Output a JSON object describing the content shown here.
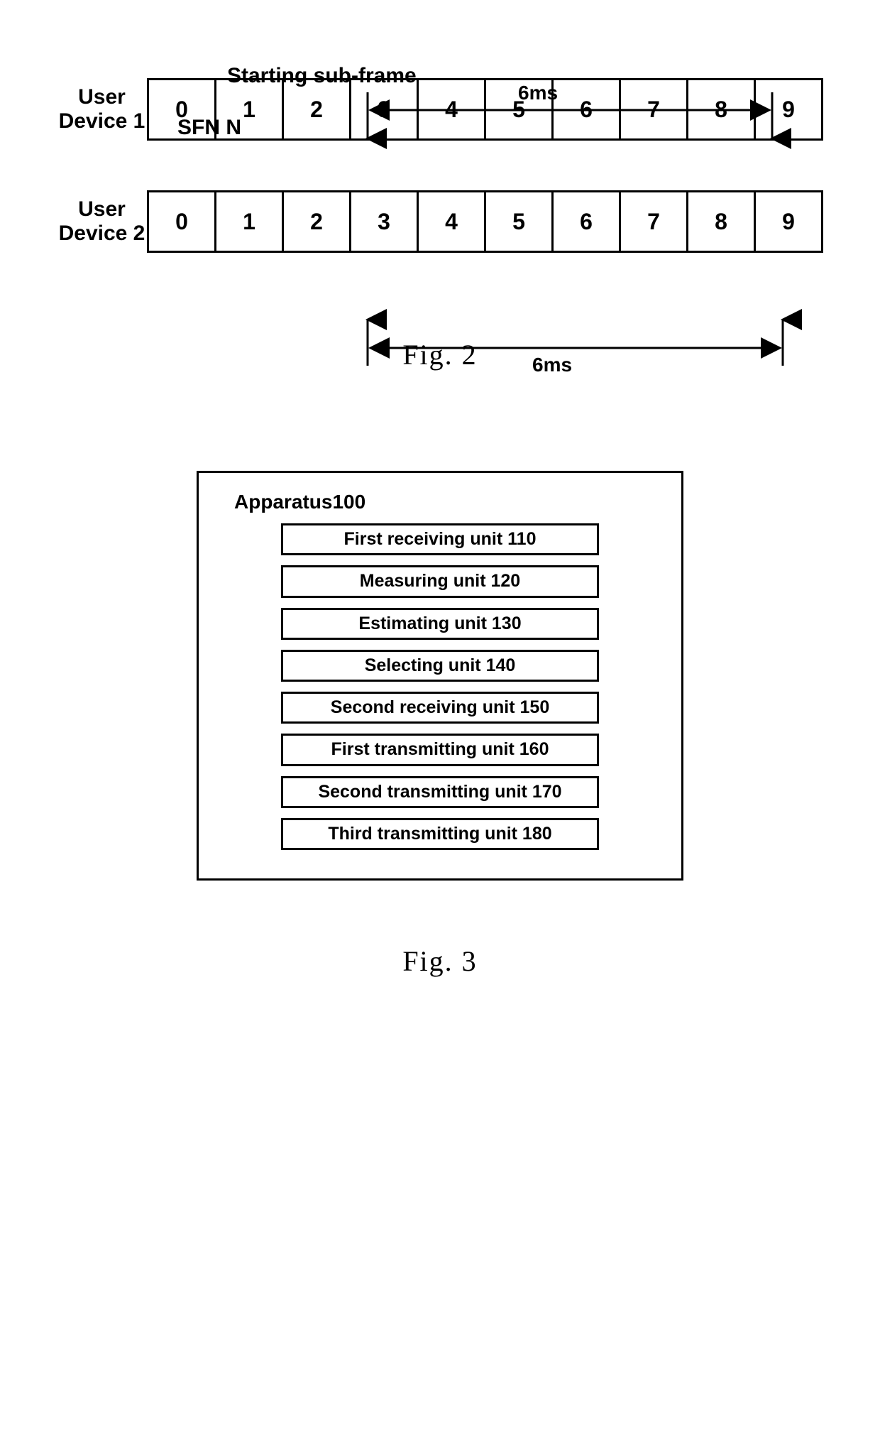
{
  "fig2": {
    "starting_label": "Starting sub-frame",
    "sfn_label": "SFN N",
    "duration_top": "6ms",
    "duration_bottom": "6ms",
    "device1_label": "User\nDevice 1",
    "device2_label": "User\nDevice 2",
    "frames1": [
      "0",
      "1",
      "2",
      "3",
      "4",
      "5",
      "6",
      "7",
      "8",
      "9"
    ],
    "frames2": [
      "0",
      "1",
      "2",
      "3",
      "4",
      "5",
      "6",
      "7",
      "8",
      "9"
    ],
    "caption": "Fig. 2"
  },
  "fig3": {
    "apparatus_title": "Apparatus100",
    "units": [
      "First receiving unit 110",
      "Measuring unit 120",
      "Estimating unit 130",
      "Selecting unit 140",
      "Second receiving unit 150",
      "First transmitting unit 160",
      "Second transmitting unit 170",
      "Third transmitting unit 180"
    ],
    "caption": "Fig. 3"
  },
  "chart_data": {
    "type": "table",
    "description": "Two user-device subframe sequences (0–9) with a 6 ms span indicated between subframe boundaries (start after subframe 2 to end after subframe 8).",
    "series": [
      {
        "name": "User Device 1",
        "values": [
          0,
          1,
          2,
          3,
          4,
          5,
          6,
          7,
          8,
          9
        ]
      },
      {
        "name": "User Device 2",
        "values": [
          0,
          1,
          2,
          3,
          4,
          5,
          6,
          7,
          8,
          9
        ]
      }
    ],
    "annotations": [
      {
        "label": "Starting sub-frame",
        "pointsTo": "boundary after subframe 2 (Device 1)"
      },
      {
        "label": "6ms",
        "span": "subframes 3–8 inclusive (6 subframes)",
        "device": "User Device 1"
      },
      {
        "label": "6ms",
        "span": "subframes 3–8 inclusive (6 subframes)",
        "device": "User Device 2"
      }
    ],
    "sfn": "SFN N"
  }
}
